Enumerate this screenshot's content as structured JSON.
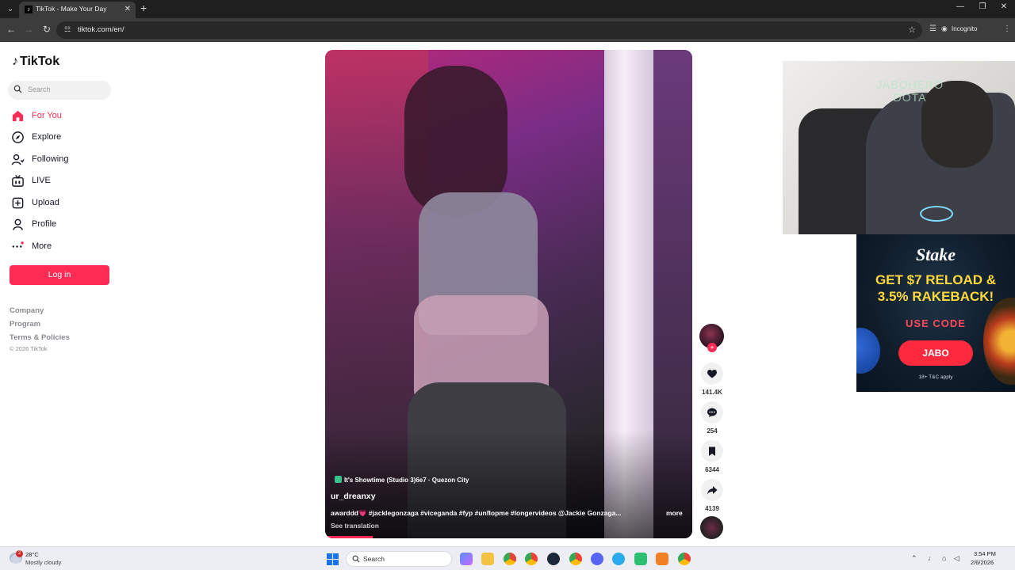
{
  "browser": {
    "tab_title": "TikTok - Make Your Day",
    "url": "tiktok.com/en/",
    "incognito_label": "Incognito"
  },
  "sidebar": {
    "logo": "TikTok",
    "search_placeholder": "Search",
    "nav": [
      {
        "label": "For You",
        "icon": "home-icon",
        "active": true
      },
      {
        "label": "Explore",
        "icon": "compass-icon"
      },
      {
        "label": "Following",
        "icon": "following-icon"
      },
      {
        "label": "LIVE",
        "icon": "live-icon"
      },
      {
        "label": "Upload",
        "icon": "upload-icon"
      },
      {
        "label": "Profile",
        "icon": "profile-icon"
      },
      {
        "label": "More",
        "icon": "more-icon"
      }
    ],
    "login_label": "Log in",
    "footer": [
      "Company",
      "Program",
      "Terms & Policies"
    ],
    "copyright": "© 2026 TikTok"
  },
  "video": {
    "location": "It's Showtime (Studio 3)6e7 · Quezon City",
    "username": "ur_dreanxy",
    "caption": "awarddd💗 #jacklegonzaga #viceganda #fyp #unflopme #longervideos @Jackie Gonzaga...",
    "more_label": "more",
    "translate_label": "See translation",
    "progress": 0.13
  },
  "actions": {
    "likes": "141.4K",
    "comments": "254",
    "saves": "6344",
    "shares": "4139"
  },
  "overlay": {
    "cam_text_line1": "JABOHERO",
    "cam_text_line2": "DOTA",
    "ad_logo": "Stake",
    "ad_headline1": "GET $7 RELOAD &",
    "ad_headline2": "3.5% RAKEBACK!",
    "ad_code_label": "USE CODE",
    "ad_code": "JABO",
    "ad_fine": "18+  T&C apply"
  },
  "taskbar": {
    "weather_temp": "28°C",
    "weather_desc": "Mostly cloudy",
    "weather_badge": "2",
    "search_placeholder": "Search",
    "time": "3:54 PM",
    "date": "2/6/2026"
  },
  "colors": {
    "accent": "#fe2c55"
  }
}
